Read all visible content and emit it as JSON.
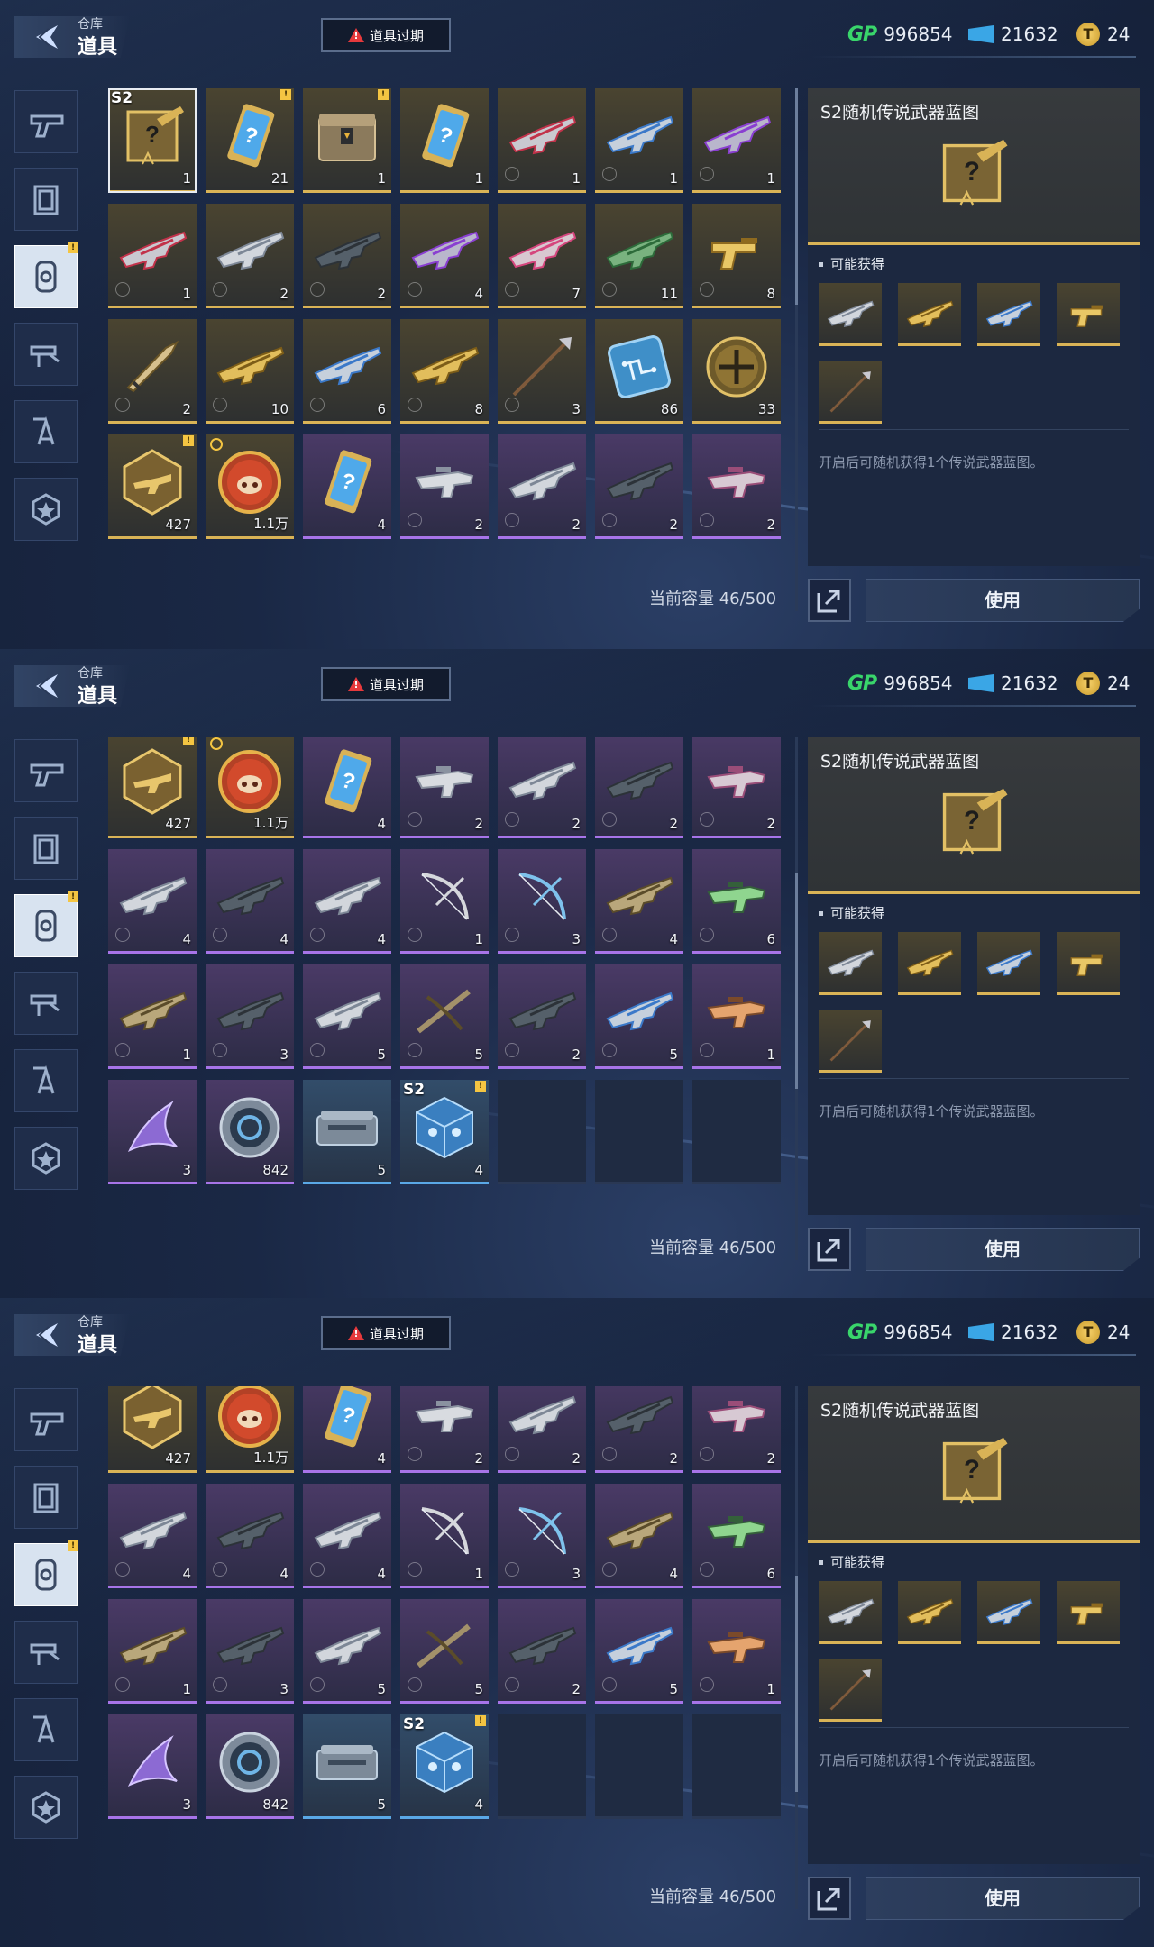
{
  "header": {
    "crumb": "仓库",
    "title": "道具",
    "notice_label": "道具过期",
    "currencies": [
      {
        "icon": "gp-icon",
        "label": "GP",
        "value": "996854"
      },
      {
        "icon": "ticket-icon",
        "value": "21632"
      },
      {
        "icon": "coin-icon",
        "glyph": "T",
        "value": "24"
      }
    ]
  },
  "rail": [
    {
      "name": "pistol",
      "icon": "pistol-icon",
      "active": false,
      "badge": false
    },
    {
      "name": "frame",
      "icon": "frame-icon",
      "active": false,
      "badge": false
    },
    {
      "name": "consumables",
      "icon": "card-icon",
      "active": true,
      "badge": true
    },
    {
      "name": "attachments",
      "icon": "weapon-parts-icon",
      "active": false,
      "badge": false
    },
    {
      "name": "blueprints",
      "icon": "blueprint-icon",
      "active": false,
      "badge": false
    },
    {
      "name": "badges",
      "icon": "star-badge-icon",
      "active": false,
      "badge": false
    }
  ],
  "badge_glyph": "!",
  "season_label": "S2",
  "items": [
    {
      "kind": "blueprint-box",
      "rarity": "gold",
      "count": "1",
      "season": true,
      "selected": true
    },
    {
      "kind": "card",
      "rarity": "gold",
      "count": "21",
      "badge": true
    },
    {
      "kind": "crate",
      "rarity": "gold",
      "count": "1",
      "badge": true
    },
    {
      "kind": "card",
      "rarity": "gold",
      "count": "1"
    },
    {
      "kind": "rifle-red",
      "rarity": "gold",
      "count": "1"
    },
    {
      "kind": "rifle-blue",
      "rarity": "gold",
      "count": "1"
    },
    {
      "kind": "rifle-purple",
      "rarity": "gold",
      "count": "1"
    },
    {
      "kind": "rifle-red",
      "rarity": "gold",
      "count": "1"
    },
    {
      "kind": "rifle-silver",
      "rarity": "gold",
      "count": "2"
    },
    {
      "kind": "rifle-dark",
      "rarity": "gold",
      "count": "2"
    },
    {
      "kind": "rifle-purple",
      "rarity": "gold",
      "count": "4"
    },
    {
      "kind": "rifle-pink",
      "rarity": "gold",
      "count": "7"
    },
    {
      "kind": "rifle-green",
      "rarity": "gold",
      "count": "11"
    },
    {
      "kind": "pistol-gold",
      "rarity": "gold",
      "count": "8"
    },
    {
      "kind": "knife",
      "rarity": "gold",
      "count": "2"
    },
    {
      "kind": "rifle-gold",
      "rarity": "gold",
      "count": "10"
    },
    {
      "kind": "rifle-blue",
      "rarity": "gold",
      "count": "6"
    },
    {
      "kind": "rifle-gold",
      "rarity": "gold",
      "count": "8"
    },
    {
      "kind": "spear",
      "rarity": "gold",
      "count": "3"
    },
    {
      "kind": "chip",
      "rarity": "gold",
      "count": "86"
    },
    {
      "kind": "medal",
      "rarity": "gold",
      "count": "33"
    },
    {
      "kind": "hex-gun",
      "rarity": "gold",
      "count": "427",
      "badge": true
    },
    {
      "kind": "pig-coin",
      "rarity": "gold",
      "count": "1.1万",
      "timer": true
    },
    {
      "kind": "card",
      "rarity": "purple",
      "count": "4"
    },
    {
      "kind": "smg-silver",
      "rarity": "purple",
      "count": "2"
    },
    {
      "kind": "rifle-silver",
      "rarity": "purple",
      "count": "2"
    },
    {
      "kind": "rifle-dark",
      "rarity": "purple",
      "count": "2"
    },
    {
      "kind": "smg-pink",
      "rarity": "purple",
      "count": "2"
    },
    {
      "kind": "rifle-silver",
      "rarity": "purple",
      "count": "4"
    },
    {
      "kind": "rifle-dark",
      "rarity": "purple",
      "count": "4"
    },
    {
      "kind": "rifle-silver",
      "rarity": "purple",
      "count": "4"
    },
    {
      "kind": "bow",
      "rarity": "purple",
      "count": "1"
    },
    {
      "kind": "bow-blue",
      "rarity": "purple",
      "count": "3"
    },
    {
      "kind": "rifle-tan",
      "rarity": "purple",
      "count": "4"
    },
    {
      "kind": "smg-green",
      "rarity": "purple",
      "count": "6"
    },
    {
      "kind": "rifle-tan",
      "rarity": "purple",
      "count": "1"
    },
    {
      "kind": "rifle-dark",
      "rarity": "purple",
      "count": "3"
    },
    {
      "kind": "rifle-silver",
      "rarity": "purple",
      "count": "5"
    },
    {
      "kind": "crossbow",
      "rarity": "purple",
      "count": "5"
    },
    {
      "kind": "rifle-dark",
      "rarity": "purple",
      "count": "2"
    },
    {
      "kind": "rifle-blue",
      "rarity": "purple",
      "count": "5"
    },
    {
      "kind": "smg-orange",
      "rarity": "purple",
      "count": "1"
    },
    {
      "kind": "claw",
      "rarity": "purple",
      "count": "3"
    },
    {
      "kind": "ring",
      "rarity": "purple",
      "count": "842"
    },
    {
      "kind": "case",
      "rarity": "blue",
      "count": "5"
    },
    {
      "kind": "cube",
      "rarity": "blue",
      "count": "4",
      "season": true,
      "badge": true
    },
    {
      "kind": "empty"
    },
    {
      "kind": "empty"
    },
    {
      "kind": "empty"
    }
  ],
  "capacity": "当前容量 46/500",
  "detail": {
    "title": "S2随机传说武器蓝图",
    "obtain_label": "可能获得",
    "rewards": [
      "rifle-silver",
      "rifle-gold",
      "rifle-blue",
      "pistol-gold",
      "spear"
    ],
    "description": "开启后可随机获得1个传说武器蓝图。"
  },
  "use_label": "使用",
  "colors": {
    "gold_rarity": "#d9b356",
    "purple_rarity": "#a774e8",
    "blue_rarity": "#5aa8e6",
    "gp_green": "#39d56b",
    "warning_red": "#e6393c",
    "badge_yellow": "#f4c542"
  }
}
